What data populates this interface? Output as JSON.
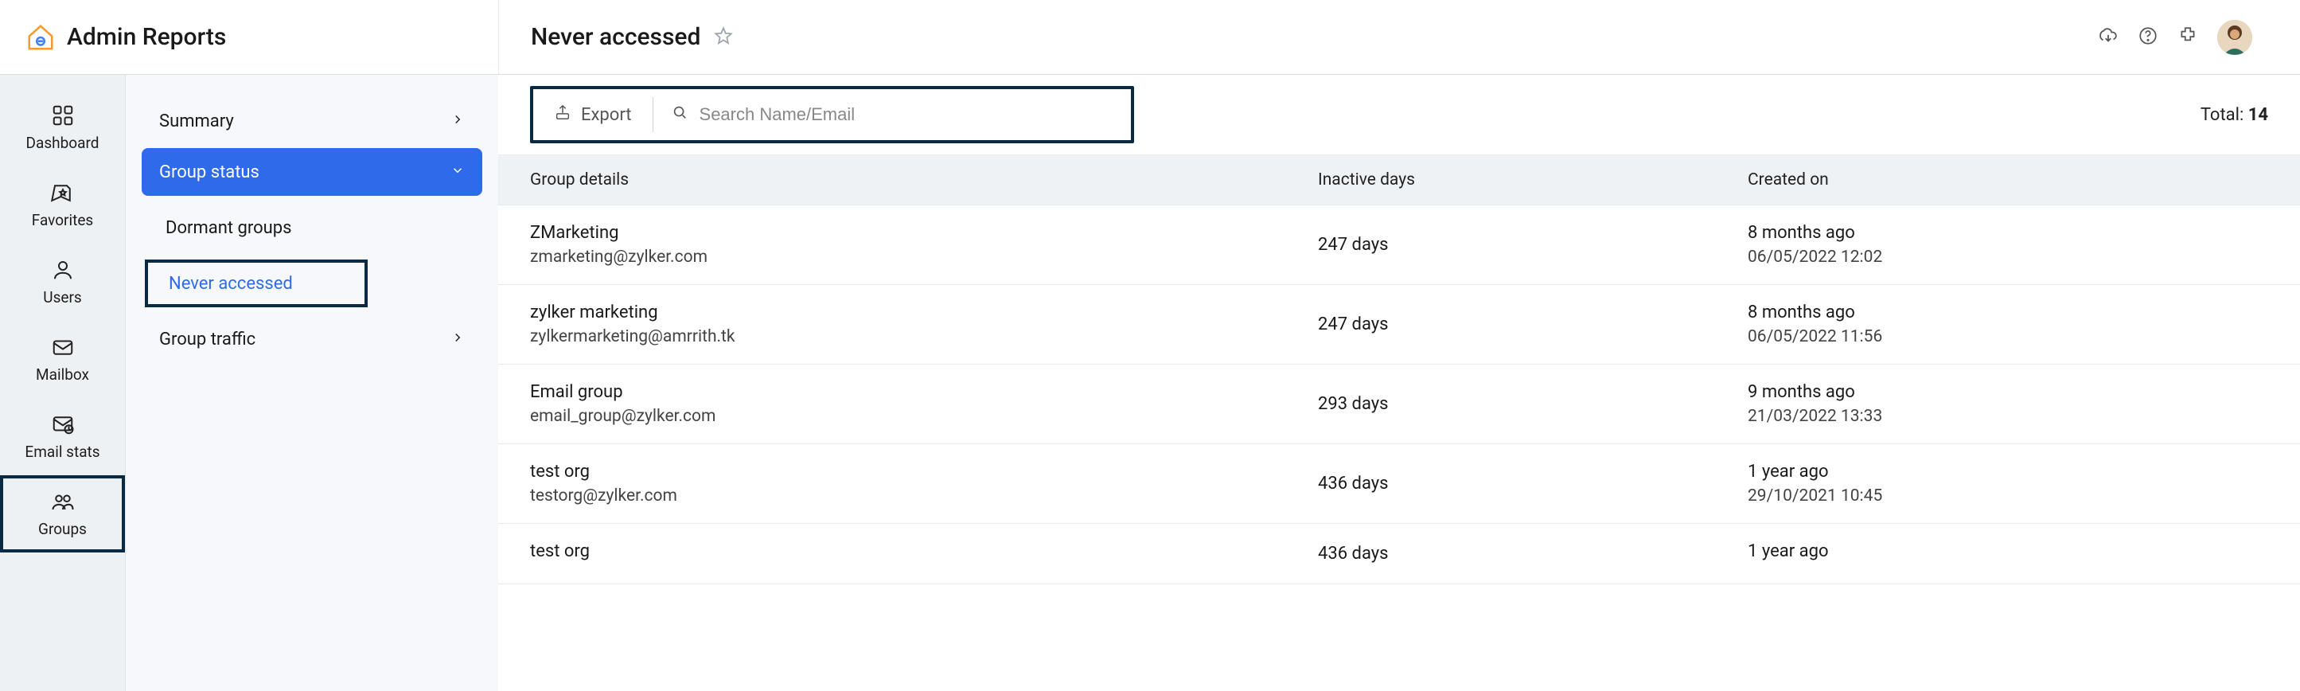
{
  "brand": {
    "title": "Admin Reports"
  },
  "page": {
    "title": "Never accessed"
  },
  "nav": {
    "items": [
      {
        "label": "Dashboard"
      },
      {
        "label": "Favorites"
      },
      {
        "label": "Users"
      },
      {
        "label": "Mailbox"
      },
      {
        "label": "Email stats"
      },
      {
        "label": "Groups"
      }
    ]
  },
  "subnav": {
    "summary": "Summary",
    "group_status": "Group status",
    "dormant": "Dormant groups",
    "never_accessed": "Never accessed",
    "group_traffic": "Group traffic"
  },
  "toolbar": {
    "export_label": "Export",
    "search_placeholder": "Search Name/Email",
    "total_prefix": "Total: ",
    "total_value": "14"
  },
  "columns": {
    "group_details": "Group details",
    "inactive_days": "Inactive days",
    "created_on": "Created on"
  },
  "rows": [
    {
      "name": "ZMarketing",
      "email": "zmarketing@zylker.com",
      "inactive": "247 days",
      "rel": "8 months ago",
      "date": "06/05/2022 12:02"
    },
    {
      "name": "zylker marketing",
      "email": "zylkermarketing@amrrith.tk",
      "inactive": "247 days",
      "rel": "8 months ago",
      "date": "06/05/2022 11:56"
    },
    {
      "name": "Email group",
      "email": "email_group@zylker.com",
      "inactive": "293 days",
      "rel": "9 months ago",
      "date": "21/03/2022 13:33"
    },
    {
      "name": "test org",
      "email": "testorg@zylker.com",
      "inactive": "436 days",
      "rel": "1 year ago",
      "date": "29/10/2021 10:45"
    },
    {
      "name": "test org",
      "email": "",
      "inactive": "436 days",
      "rel": "1 year ago",
      "date": ""
    }
  ]
}
